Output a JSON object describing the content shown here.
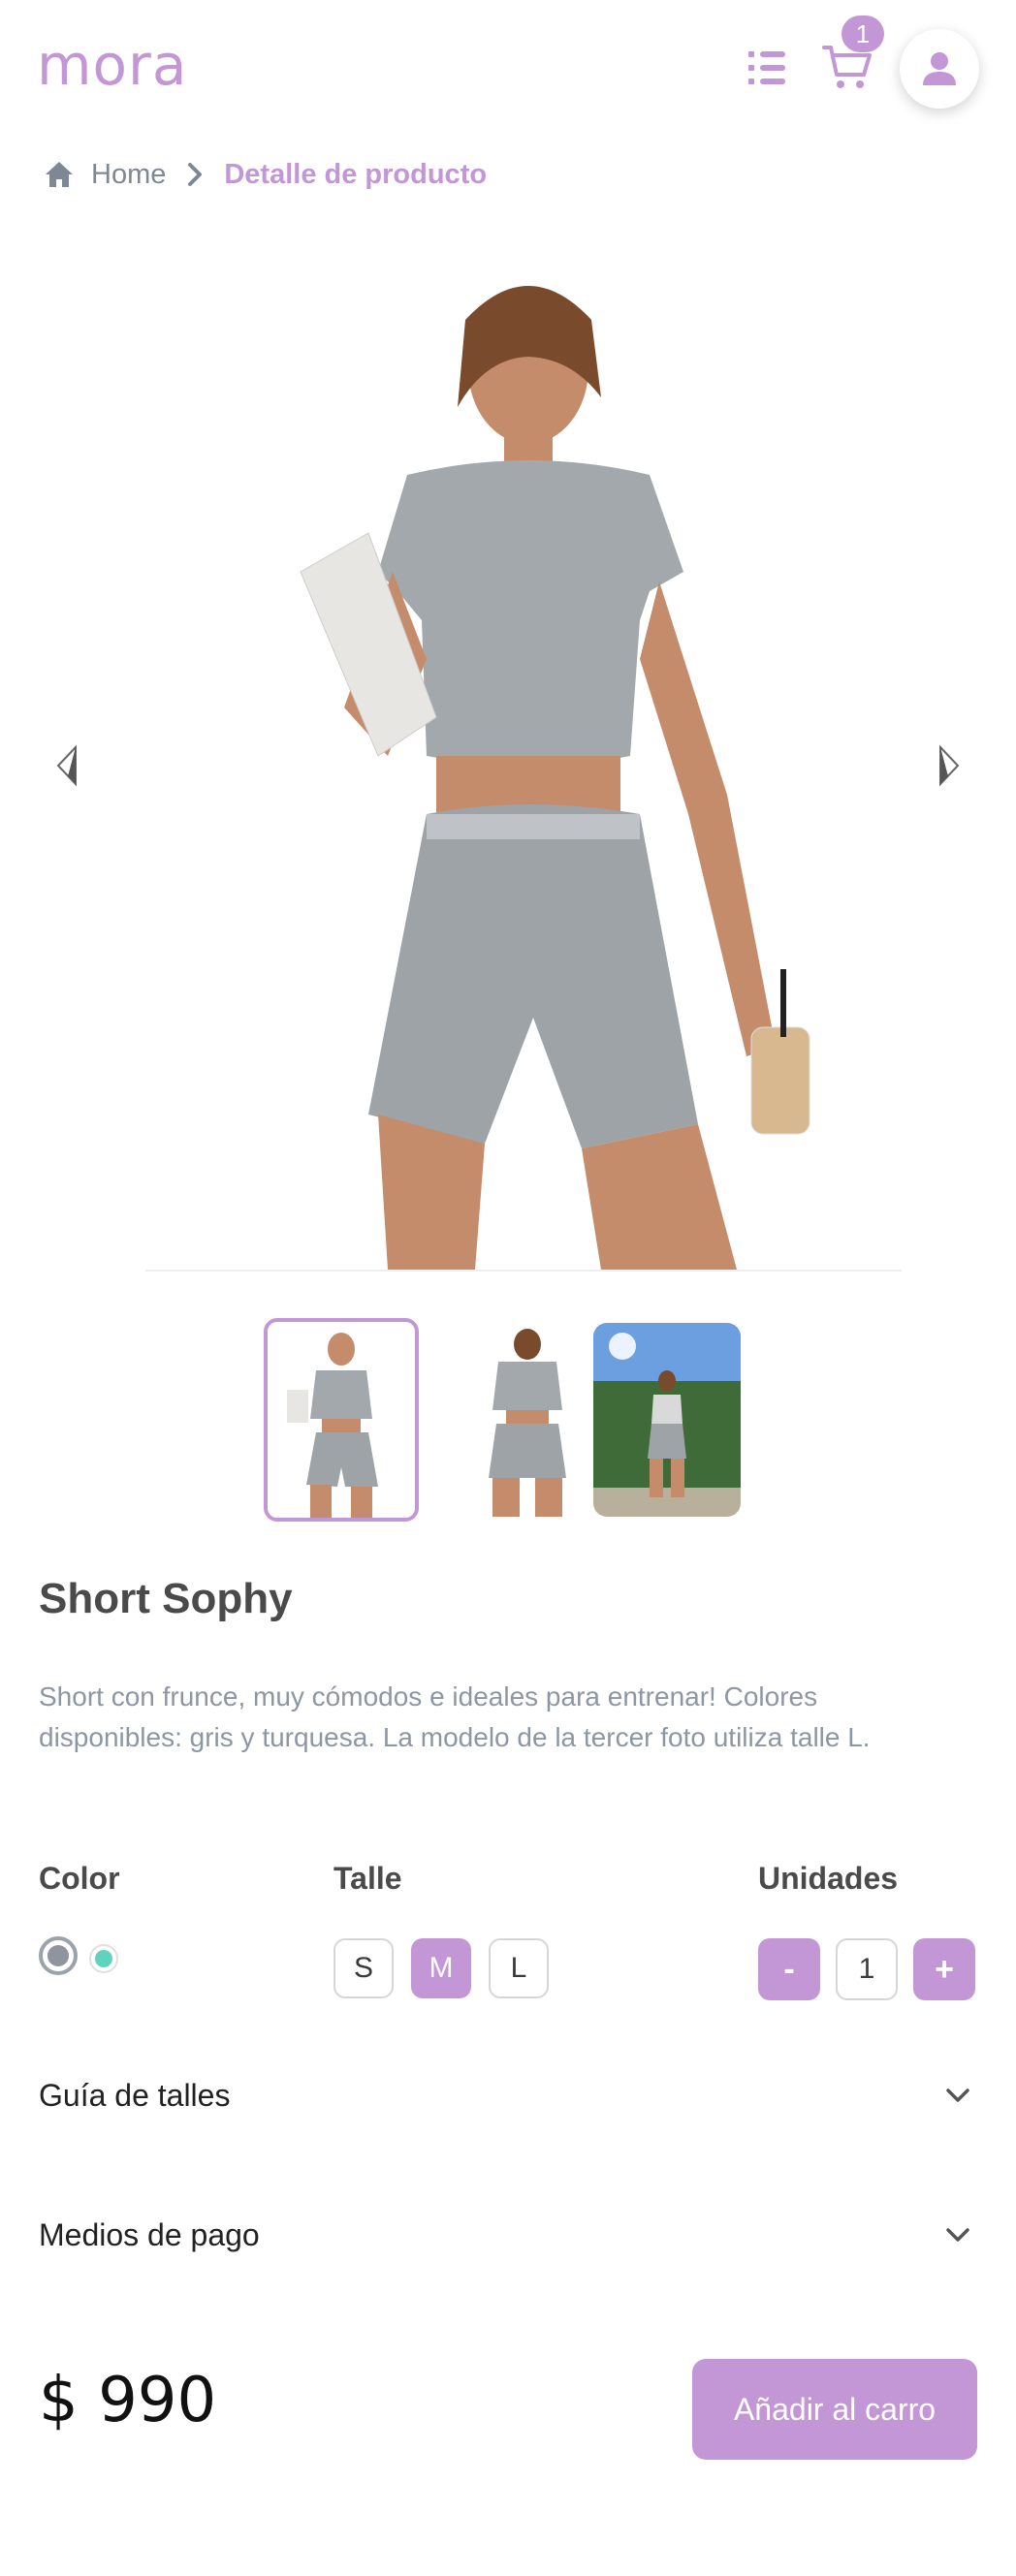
{
  "brand": {
    "logo_text": "mora",
    "accent": "#c396d6"
  },
  "header": {
    "cart_count": "1"
  },
  "breadcrumb": {
    "home": "Home",
    "current": "Detalle de producto"
  },
  "product": {
    "title": "Short Sophy",
    "description": "Short con frunce, muy cómodos e ideales para entrenar! Colores disponibles: gris y turquesa. La modelo de la tercer foto utiliza talle L.",
    "price": "$ 990"
  },
  "options": {
    "color_label": "Color",
    "colors": [
      {
        "name": "gris",
        "hex": "#8e959f",
        "selected": true
      },
      {
        "name": "turquesa",
        "hex": "#5fd3bd",
        "selected": false
      }
    ],
    "size_label": "Talle",
    "sizes": [
      "S",
      "M",
      "L"
    ],
    "selected_size": "M",
    "units_label": "Unidades",
    "minus": "-",
    "quantity": "1",
    "plus": "+"
  },
  "accordions": {
    "size_guide": "Guía de talles",
    "payment": "Medios de pago"
  },
  "actions": {
    "add_to_cart": "Añadir al carro"
  },
  "icons": {
    "menu": "list-icon",
    "cart": "cart-icon",
    "user": "user-icon",
    "home": "home-icon",
    "chevron_right": "chevron-right-icon",
    "chevron_down": "chevron-down-icon",
    "arrow_left": "triangle-left-icon",
    "arrow_right": "triangle-right-icon"
  }
}
